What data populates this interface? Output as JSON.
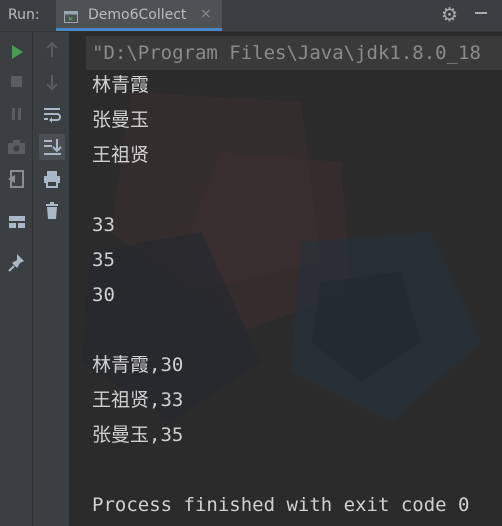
{
  "run_panel": {
    "label": "Run:",
    "tab": {
      "label": "Demo6Collect",
      "close": "×"
    }
  },
  "toolbar": {
    "left": [
      "rerun-icon",
      "stop-icon",
      "pause-icon",
      "camera-icon",
      "exit-icon",
      "layout-icon",
      "pin-icon"
    ],
    "right": [
      "up-arrow-icon",
      "down-arrow-icon",
      "soft-wrap-icon",
      "scroll-to-end-icon",
      "print-icon",
      "trash-icon"
    ]
  },
  "console": {
    "command": "\"D:\\Program Files\\Java\\jdk1.8.0_18",
    "lines": [
      "林青霞",
      "张曼玉",
      "王祖贤",
      "",
      "33",
      "35",
      "30",
      "",
      "林青霞,30",
      "王祖贤,33",
      "张曼玉,35",
      "",
      "Process finished with exit code 0"
    ]
  },
  "colors": {
    "background": "#2b2b2b",
    "panel": "#3c3f41",
    "run_green": "#499c54",
    "tab_underline": "#4a88c7"
  }
}
